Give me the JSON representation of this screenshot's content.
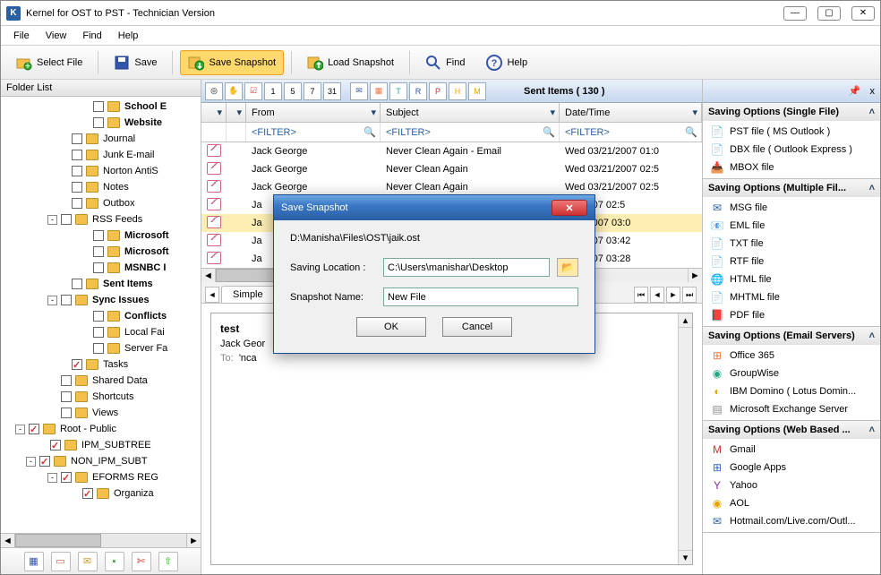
{
  "window": {
    "title": "Kernel for OST to PST - Technician Version"
  },
  "menu": {
    "file": "File",
    "view": "View",
    "find": "Find",
    "help": "Help"
  },
  "toolbar": {
    "select_file": "Select File",
    "save": "Save",
    "save_snapshot": "Save Snapshot",
    "load_snapshot": "Load Snapshot",
    "find": "Find",
    "help": "Help"
  },
  "folder_panel": {
    "title": "Folder List"
  },
  "tree": [
    {
      "indent": 84,
      "exp": "",
      "chk": false,
      "label": "School E",
      "bold": true
    },
    {
      "indent": 84,
      "exp": "",
      "chk": false,
      "label": "Website",
      "bold": true
    },
    {
      "indent": 60,
      "exp": "",
      "chk": false,
      "label": "Journal",
      "bold": false,
      "special": "journal"
    },
    {
      "indent": 60,
      "exp": "",
      "chk": false,
      "label": "Junk E-mail",
      "bold": false
    },
    {
      "indent": 60,
      "exp": "",
      "chk": false,
      "label": "Norton AntiS",
      "bold": false
    },
    {
      "indent": 60,
      "exp": "",
      "chk": false,
      "label": "Notes",
      "bold": false
    },
    {
      "indent": 60,
      "exp": "",
      "chk": false,
      "label": "Outbox",
      "bold": false
    },
    {
      "indent": 48,
      "exp": "-",
      "chk": false,
      "label": "RSS Feeds",
      "bold": false
    },
    {
      "indent": 84,
      "exp": "",
      "chk": false,
      "label": "Microsoft",
      "bold": true
    },
    {
      "indent": 84,
      "exp": "",
      "chk": false,
      "label": "Microsoft",
      "bold": true
    },
    {
      "indent": 84,
      "exp": "",
      "chk": false,
      "label": "MSNBC I",
      "bold": true
    },
    {
      "indent": 60,
      "exp": "",
      "chk": false,
      "label": "Sent Items",
      "bold": true
    },
    {
      "indent": 48,
      "exp": "-",
      "chk": false,
      "label": "Sync Issues",
      "bold": true
    },
    {
      "indent": 84,
      "exp": "",
      "chk": false,
      "label": "Conflicts",
      "bold": true
    },
    {
      "indent": 84,
      "exp": "",
      "chk": false,
      "label": "Local Fai",
      "bold": false
    },
    {
      "indent": 84,
      "exp": "",
      "chk": false,
      "label": "Server Fa",
      "bold": false
    },
    {
      "indent": 60,
      "exp": "",
      "chk": true,
      "label": "Tasks",
      "bold": false,
      "special": "tasks"
    },
    {
      "indent": 48,
      "exp": "",
      "chk": false,
      "label": "Shared Data",
      "bold": false
    },
    {
      "indent": 48,
      "exp": "",
      "chk": false,
      "label": "Shortcuts",
      "bold": false
    },
    {
      "indent": 48,
      "exp": "",
      "chk": false,
      "label": "Views",
      "bold": false
    },
    {
      "indent": 12,
      "exp": "-",
      "chk": true,
      "label": "Root - Public",
      "bold": false
    },
    {
      "indent": 36,
      "exp": "",
      "chk": true,
      "label": "IPM_SUBTREE",
      "bold": false
    },
    {
      "indent": 24,
      "exp": "-",
      "chk": true,
      "label": "NON_IPM_SUBT",
      "bold": false
    },
    {
      "indent": 48,
      "exp": "-",
      "chk": true,
      "label": "EFORMS REG",
      "bold": false
    },
    {
      "indent": 72,
      "exp": "",
      "chk": true,
      "label": "Organiza",
      "bold": false
    }
  ],
  "grid": {
    "title": "Sent Items ( 130 )",
    "cols": {
      "from": "From",
      "subject": "Subject",
      "date": "Date/Time"
    },
    "filter": "<FILTER>",
    "rows": [
      {
        "from": "Jack George",
        "subject": "Never Clean Again - Email",
        "date": "Wed 03/21/2007 01:0"
      },
      {
        "from": "Jack George",
        "subject": "Never Clean Again",
        "date": "Wed 03/21/2007 02:5"
      },
      {
        "from": "Jack George",
        "subject": "Never Clean Again",
        "date": "Wed 03/21/2007 02:5"
      },
      {
        "from": "Ja",
        "subject": "",
        "date": "/21/2007 02:5"
      },
      {
        "from": "Ja",
        "subject": "",
        "date": "3/21/2007 03:0",
        "sel": true
      },
      {
        "from": "Ja",
        "subject": "",
        "date": "/22/2007 03:42"
      },
      {
        "from": "Ja",
        "subject": "",
        "date": "/22/2007 03:28"
      }
    ]
  },
  "preview": {
    "tab": "Simple",
    "subject": "test",
    "from": "Jack Geor",
    "to_label": "To:",
    "to_value": "'nca"
  },
  "right": {
    "pin": "📌",
    "x_icon": "x",
    "groups": [
      {
        "title": "Saving Options (Single File)",
        "items": [
          {
            "icon": "📄",
            "color": "#e8a400",
            "label": "PST file ( MS Outlook )"
          },
          {
            "icon": "📄",
            "color": "#2a8",
            "label": "DBX file ( Outlook Express )"
          },
          {
            "icon": "📥",
            "color": "#2a5fa3",
            "label": "MBOX file"
          }
        ]
      },
      {
        "title": "Saving Options (Multiple Fil...",
        "items": [
          {
            "icon": "✉",
            "color": "#2a5fa3",
            "label": "MSG file"
          },
          {
            "icon": "📧",
            "color": "#2a8",
            "label": "EML file"
          },
          {
            "icon": "📄",
            "color": "#2a5fa3",
            "label": "TXT file"
          },
          {
            "icon": "📄",
            "color": "#2a5fa3",
            "label": "RTF file"
          },
          {
            "icon": "🌐",
            "color": "#2a5fa3",
            "label": "HTML file"
          },
          {
            "icon": "📄",
            "color": "#e8a400",
            "label": "MHTML file"
          },
          {
            "icon": "📕",
            "color": "#c33",
            "label": "PDF file"
          }
        ]
      },
      {
        "title": "Saving Options (Email Servers)",
        "items": [
          {
            "icon": "⊞",
            "color": "#e74",
            "label": "Office 365"
          },
          {
            "icon": "◉",
            "color": "#2a8",
            "label": "GroupWise"
          },
          {
            "icon": "◐",
            "color": "#e8a400",
            "label": "IBM Domino ( Lotus Domin..."
          },
          {
            "icon": "▤",
            "color": "#888",
            "label": "Microsoft Exchange Server"
          }
        ]
      },
      {
        "title": "Saving Options (Web Based ...",
        "items": [
          {
            "icon": "M",
            "color": "#c33",
            "label": "Gmail"
          },
          {
            "icon": "⊞",
            "color": "#36c",
            "label": "Google Apps"
          },
          {
            "icon": "Y",
            "color": "#7b2aa3",
            "label": "Yahoo"
          },
          {
            "icon": "◉",
            "color": "#e8a400",
            "label": "AOL"
          },
          {
            "icon": "✉",
            "color": "#2a5fa3",
            "label": "Hotmail.com/Live.com/Outl..."
          }
        ]
      }
    ]
  },
  "modal": {
    "title": "Save Snapshot",
    "path": "D:\\Manisha\\Files\\OST\\jaik.ost",
    "loc_label": "Saving Location :",
    "loc_value": "C:\\Users\\manishar\\Desktop",
    "name_label": "Snapshot Name:",
    "name_value": "New File",
    "ok": "OK",
    "cancel": "Cancel"
  }
}
